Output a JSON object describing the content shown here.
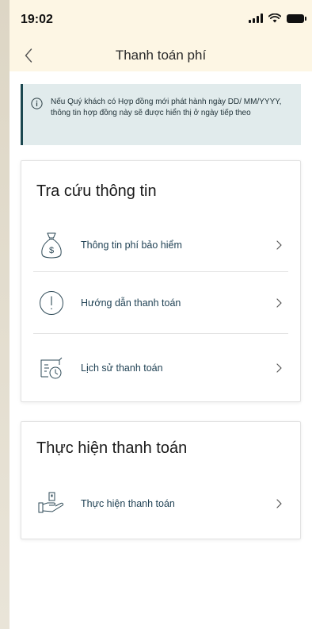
{
  "status_bar": {
    "time": "19:02",
    "icons": [
      "signal-icon",
      "wifi-icon",
      "battery-icon"
    ]
  },
  "header": {
    "back_icon": "chevron-left-icon",
    "title": "Thanh toán phí"
  },
  "notice": {
    "icon": "info-icon",
    "text": "Nếu Quý khách có Hợp đồng mới phát hành ngày DD/ MM/YYYY, thông tin hợp đồng này sẽ được hiển thị ở ngày tiếp theo"
  },
  "lookup_section": {
    "title": "Tra cứu thông tin",
    "items": [
      {
        "label": "Thông tin phí bảo hiểm",
        "icon": "money-bag-icon"
      },
      {
        "label": "Hướng dẫn thanh toán",
        "icon": "exclamation-circle-icon"
      },
      {
        "label": "Lịch sử thanh toán",
        "icon": "payment-history-icon"
      }
    ]
  },
  "payment_section": {
    "title": "Thực hiện thanh toán",
    "items": [
      {
        "label": "Thực hiện thanh toán",
        "icon": "hand-payment-icon"
      }
    ]
  },
  "colors": {
    "header_bg": "#fdf6e4",
    "notice_bg": "#e1ebec",
    "notice_accent": "#1b4750",
    "label_text": "#1d3f52"
  }
}
